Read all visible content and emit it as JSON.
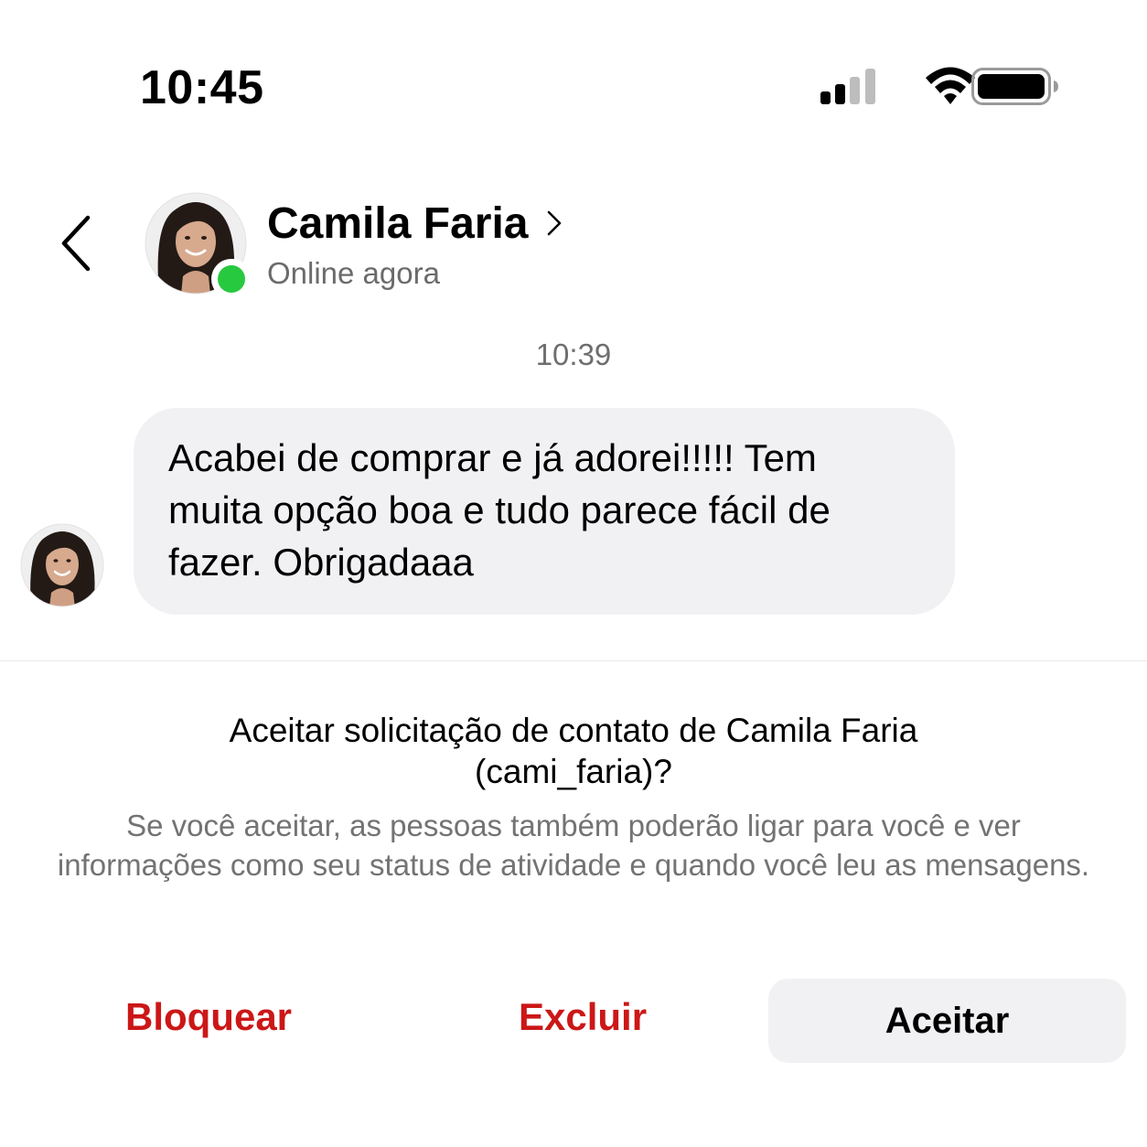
{
  "status_bar": {
    "time": "10:45"
  },
  "header": {
    "contact_name": "Camila Faria",
    "contact_status": "Online agora",
    "online_color": "#27c93f"
  },
  "chat": {
    "timestamp": "10:39",
    "messages": [
      {
        "sender": "Camila Faria",
        "text": "Acabei de comprar e já adorei!!!!! Tem muita opção boa e tudo parece fácil de fazer. Obrigadaaa"
      }
    ]
  },
  "request": {
    "title": "Aceitar solicitação de contato de Camila Faria (cami_faria)?",
    "description": "Se você aceitar, as pessoas também poderão ligar para você e ver informações como seu status de atividade e quando você leu as mensagens.",
    "block_label": "Bloquear",
    "delete_label": "Excluir",
    "accept_label": "Aceitar",
    "destructive_color": "#cc1717"
  },
  "icons": {
    "signal": "cellular-signal-icon",
    "wifi": "wifi-icon",
    "battery": "battery-icon",
    "back": "chevron-left-icon",
    "chevron": "chevron-right-icon"
  }
}
